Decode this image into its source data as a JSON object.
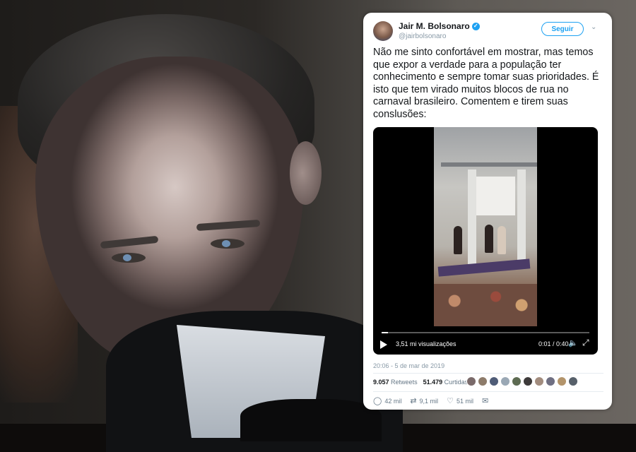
{
  "tweet": {
    "author_name": "Jair M. Bolsonaro",
    "author_handle": "@jairbolsonaro",
    "follow_label": "Seguir",
    "text": "Não me sinto confortável em mostrar, mas temos que expor a verdade para a população ter conhecimento e sempre tomar suas prioridades. É isto que tem virado muitos blocos de rua no carnaval brasileiro. Comentem e tirem suas conslusões:",
    "timestamp": "20:06 - 5 de mar de 2019",
    "retweets_count": "9.057",
    "retweets_label": "Retweets",
    "likes_count": "51.479",
    "likes_label": "Curtidas",
    "video": {
      "views": "3,51 mi visualizações",
      "time": "0:01 / 0:40",
      "progress": 0.03
    },
    "actions": {
      "reply_count": "42 mil",
      "retweet_count": "9,1 mil",
      "like_count": "51 mil"
    }
  },
  "colors": {
    "accent": "#1da1f2",
    "text": "#14171a",
    "muted": "#8899a6"
  }
}
